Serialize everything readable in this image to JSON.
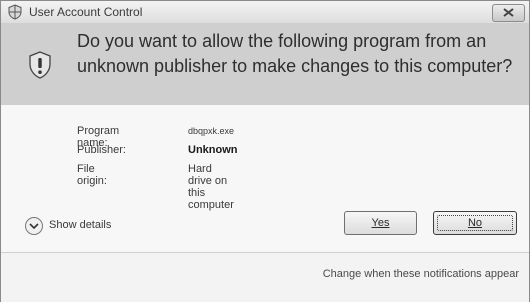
{
  "window": {
    "title": "User Account Control",
    "title_icon": "uac-shield-icon",
    "close_icon": "close-icon"
  },
  "header": {
    "message": "Do you want to allow the following program from an unknown publisher to make changes to this computer?",
    "icon": "warning-shield-icon"
  },
  "details": {
    "rows": [
      {
        "label": "Program name:",
        "value": "dbqpxk.exe"
      },
      {
        "label": "Publisher:",
        "value": "Unknown"
      },
      {
        "label": "File origin:",
        "value": "Hard drive on this computer"
      }
    ]
  },
  "actions": {
    "show_details": "Show details",
    "yes": "Yes",
    "no": "No"
  },
  "footer": {
    "link": "Change when these notifications appear"
  }
}
